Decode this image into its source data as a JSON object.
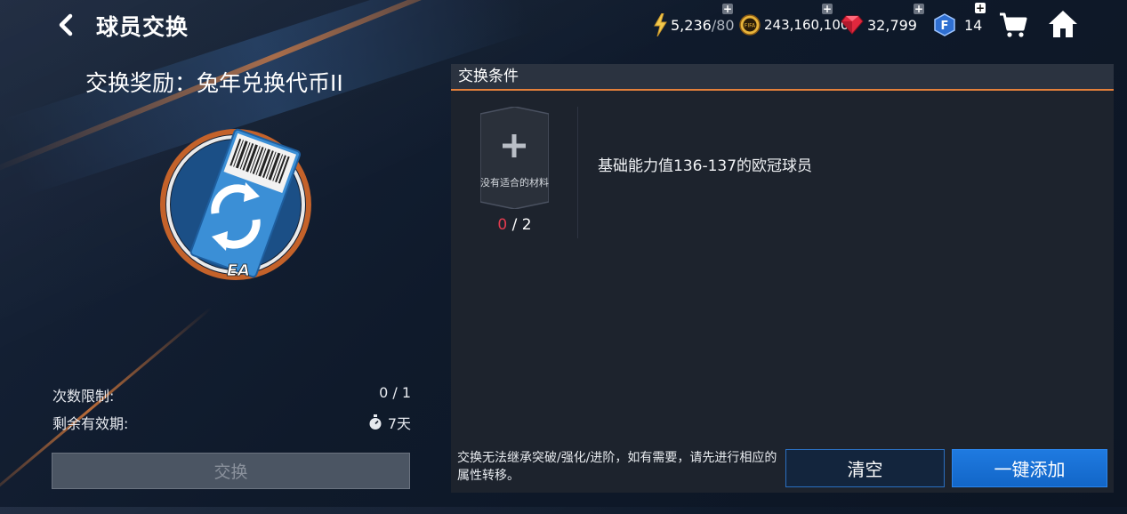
{
  "header": {
    "title": "球员交换",
    "energy": {
      "value": "5,236",
      "max": "/80"
    },
    "coins": "243,160,100",
    "gems": "32,799",
    "fifa_points": "14",
    "coin_badge": "FIFA"
  },
  "reward": {
    "title": "交换奖励：兔年兑换代币II",
    "icon_brand": "EA",
    "limit_label": "次数限制:",
    "limit_value": "0 / 1",
    "expiry_label": "剩余有效期:",
    "expiry_value": "7天",
    "exchange_button": "交换"
  },
  "panel": {
    "title": "交换条件",
    "slot_label": "没有适合的材料",
    "slot_count_current": "0",
    "slot_count_total": " / 2",
    "condition": "基础能力值136-137的欧冠球员",
    "note": "交换无法继承突破/强化/进阶，如有需要，请先进行相应的属性转移。",
    "clear_button": "清空",
    "add_all_button": "一键添加"
  },
  "colors": {
    "accent_orange": "#e4803a",
    "primary_blue": "#1f7ae0",
    "count_red": "#e23b4e"
  }
}
